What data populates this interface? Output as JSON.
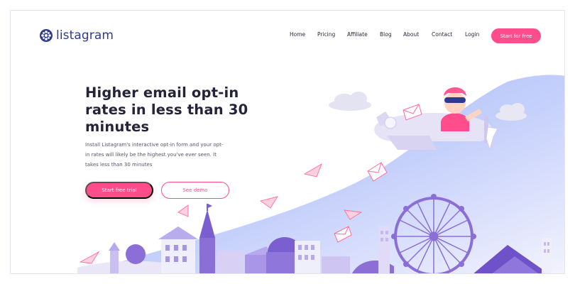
{
  "brand": {
    "name": "listagram"
  },
  "nav": {
    "items": [
      {
        "key": "home",
        "label": "Home"
      },
      {
        "key": "pricing",
        "label": "Pricing"
      },
      {
        "key": "affiliate",
        "label": "Affiliate"
      },
      {
        "key": "blog",
        "label": "Blog"
      },
      {
        "key": "about",
        "label": "About"
      },
      {
        "key": "contact",
        "label": "Contact"
      },
      {
        "key": "login",
        "label": "Login"
      }
    ],
    "cta_label": "Start for free"
  },
  "hero": {
    "title_lines": [
      "Higher email opt-in",
      "rates in less than 30",
      "minutes"
    ],
    "description_lines": [
      "Install Listagram's interactive opt-in form and your opt-",
      "in rates will likely be the highest you've ever seen. It",
      "takes less than 30 minutes"
    ],
    "primary_button": "Start free trial",
    "secondary_button": "See demo"
  },
  "colors": {
    "accent": "#ff4d8b",
    "brand": "#2e3a8c",
    "illustration_purple": "#8b6fd6",
    "sky": "#a9b9f5"
  },
  "icons": {
    "logo": "globe-flower-icon",
    "envelopes": "envelope-icon",
    "paper_planes": "paper-plane-icon"
  }
}
